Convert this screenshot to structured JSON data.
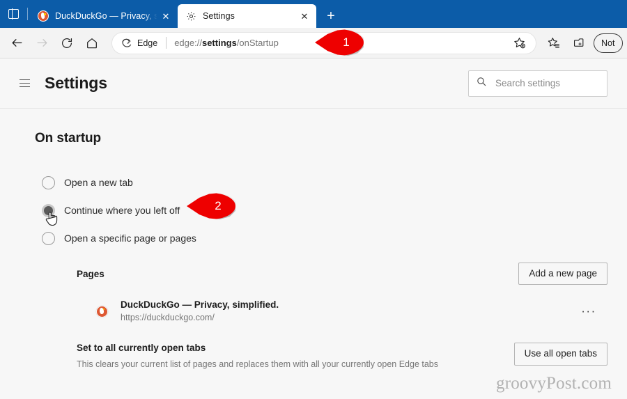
{
  "browser": {
    "tabstrip": {
      "vertical_tabs_icon": "vertical-tabs-icon",
      "new_tab_label": "+",
      "tabs": [
        {
          "title": "DuckDuckGo — Privacy, simplified.",
          "favicon": "duckduckgo-icon",
          "close_label": "✕",
          "active": false
        },
        {
          "title": "Settings",
          "favicon": "gear-icon",
          "close_label": "✕",
          "active": true
        }
      ]
    },
    "toolbar": {
      "back_icon": "back-arrow-icon",
      "forward_icon": "forward-arrow-icon",
      "refresh_icon": "refresh-icon",
      "home_icon": "home-icon",
      "edge_chip_label": "Edge",
      "url_prefix": "edge://",
      "url_bold": "settings",
      "url_suffix": "/onStartup",
      "favorite_icon": "add-favorite-star-icon",
      "favorites_icon": "favorites-list-icon",
      "collections_icon": "collections-icon",
      "profile_label": "Not"
    }
  },
  "settings": {
    "header": {
      "menu_icon": "hamburger-menu-icon",
      "title": "Settings",
      "search": {
        "icon": "search-icon",
        "placeholder": "Search settings",
        "value": ""
      }
    },
    "section_title": "On startup",
    "options": [
      {
        "label": "Open a new tab",
        "selected": false,
        "hovered": false
      },
      {
        "label": "Continue where you left off",
        "selected": false,
        "hovered": true
      },
      {
        "label": "Open a specific page or pages",
        "selected": false,
        "hovered": false
      }
    ],
    "pages": {
      "label": "Pages",
      "add_button": "Add a new page",
      "items": [
        {
          "favicon": "duckduckgo-icon",
          "title": "DuckDuckGo — Privacy, simplified.",
          "url": "https://duckduckgo.com/",
          "more_label": "···"
        }
      ]
    },
    "open_tabs": {
      "title": "Set to all currently open tabs",
      "description": "This clears your current list of pages and replaces them with all your currently open Edge tabs",
      "button": "Use all open tabs"
    }
  },
  "callouts": [
    {
      "number": "1"
    },
    {
      "number": "2"
    }
  ],
  "watermark": "groovyPost.com",
  "colors": {
    "tabstrip_blue": "#0c5ca8",
    "callout_red": "#ee0000",
    "toolbar_bg": "#f3f3f3",
    "content_bg": "#f7f7f7",
    "duckduckgo_orange": "#de5833"
  }
}
